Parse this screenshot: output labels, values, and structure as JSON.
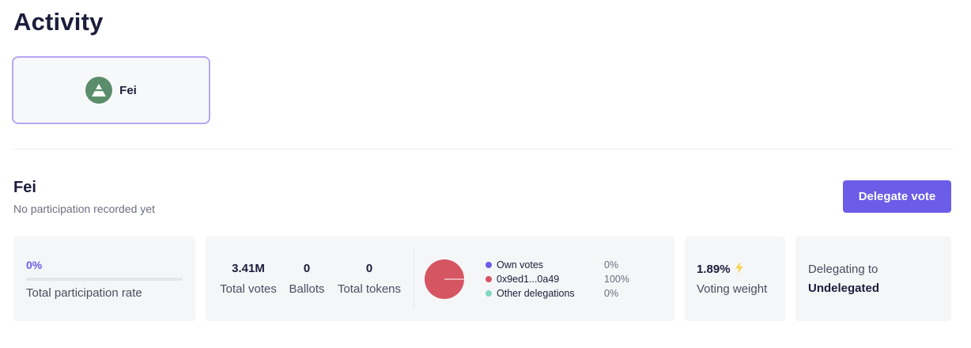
{
  "page": {
    "title": "Activity"
  },
  "dao_selector": {
    "selected_name": "Fei",
    "logo_icon": "triangle-logo-icon",
    "logo_color": "#5a8d6b",
    "accent_border": "#b8a6f2"
  },
  "section": {
    "title": "Fei",
    "subtitle": "No participation recorded yet",
    "delegate_button_label": "Delegate vote",
    "accent_color": "#6c5ce7"
  },
  "participation": {
    "value": "0%",
    "fraction": 0.0,
    "label": "Total participation rate"
  },
  "stats": {
    "total_votes": {
      "value": "3.41M",
      "label": "Total votes"
    },
    "ballots": {
      "value": "0",
      "label": "Ballots"
    },
    "total_tokens": {
      "value": "0",
      "label": "Total tokens"
    }
  },
  "distribution": {
    "items": [
      {
        "label": "Own votes",
        "percent": "0%",
        "value": 0,
        "color": "#6c5ce7"
      },
      {
        "label": "0x9ed1...0a49",
        "percent": "100%",
        "value": 100,
        "color": "#d65563"
      },
      {
        "label": "Other delegations",
        "percent": "0%",
        "value": 0,
        "color": "#7fd8c4"
      }
    ]
  },
  "voting_weight": {
    "value": "1.89%",
    "label": "Voting weight",
    "icon": "lightning-icon",
    "icon_color": "#f7d553"
  },
  "delegating": {
    "label": "Delegating to",
    "value": "Undelegated"
  }
}
